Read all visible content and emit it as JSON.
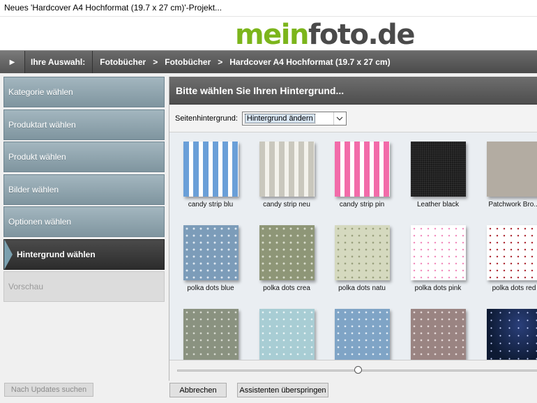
{
  "window": {
    "title": "Neues 'Hardcover A4 Hochformat (19.7 x 27 cm)'-Projekt..."
  },
  "logo": {
    "part1": "mein",
    "part2": "foto.de"
  },
  "breadcrumb": {
    "label": "Ihre Auswahl:",
    "items": [
      "Fotobücher",
      "Fotobücher",
      "Hardcover A4 Hochformat (19.7 x 27 cm)"
    ],
    "separator": ">"
  },
  "sidebar": {
    "items": [
      {
        "label": "Kategorie wählen"
      },
      {
        "label": "Produktart wählen"
      },
      {
        "label": "Produkt wählen"
      },
      {
        "label": "Bilder wählen"
      },
      {
        "label": "Optionen wählen"
      },
      {
        "label": "Hintergrund wählen"
      },
      {
        "label": "Vorschau"
      }
    ],
    "updates_button": "Nach Updates suchen"
  },
  "panel": {
    "title": "Bitte wählen Sie Ihren Hintergrund...",
    "background_label": "Seitenhintergrund:",
    "background_select": "Hintergrund ändern"
  },
  "backgrounds": [
    {
      "name": "candy strip blu",
      "color": "#6a9fd8"
    },
    {
      "name": "candy strip neu",
      "color": "#c9c7bd"
    },
    {
      "name": "candy strip pin",
      "color": "#f26ba9"
    },
    {
      "name": "Leather black",
      "color": "#1c1c1c"
    },
    {
      "name": "Patchwork Bro...",
      "color": "#b3aca2"
    },
    {
      "name": "polka dots blue",
      "color": "#7c9cb9"
    },
    {
      "name": "polka dots crea",
      "color": "#8e9677"
    },
    {
      "name": "polka dots natu",
      "color": "#d5d9bf"
    },
    {
      "name": "polka dots pink",
      "color": "#ffffff"
    },
    {
      "name": "polka dots red",
      "color": "#ffffff"
    },
    {
      "name": "",
      "color": "#8a9280"
    },
    {
      "name": "",
      "color": "#a8cdd4"
    },
    {
      "name": "",
      "color": "#7fa4c6"
    },
    {
      "name": "",
      "color": "#9a8482"
    },
    {
      "name": "",
      "color": "#0d1a33"
    }
  ],
  "footer": {
    "cancel": "Abbrechen",
    "skip": "Assistenten überspringen"
  }
}
